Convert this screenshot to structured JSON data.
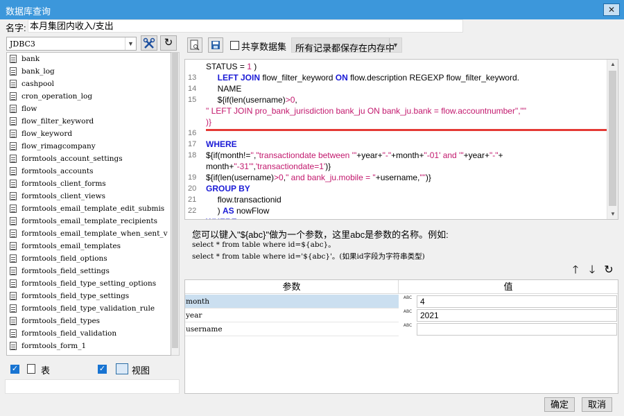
{
  "window": {
    "title": "数据库查询",
    "close_glyph": "✕"
  },
  "name_field": {
    "label": "名字:",
    "value": "本月集团内收入/支出"
  },
  "datasource": {
    "selected": "JDBC3",
    "arrow": "▼"
  },
  "tables": [
    "bank",
    "bank_log",
    "cashpool",
    "cron_operation_log",
    "flow",
    "flow_filter_keyword",
    "flow_keyword",
    "flow_rimagcompany",
    "formtools_account_settings",
    "formtools_accounts",
    "formtools_client_forms",
    "formtools_client_views",
    "formtools_email_template_edit_submis",
    "formtools_email_template_recipients",
    "formtools_email_template_when_sent_v",
    "formtools_email_templates",
    "formtools_field_options",
    "formtools_field_settings",
    "formtools_field_type_setting_options",
    "formtools_field_type_settings",
    "formtools_field_type_validation_rule",
    "formtools_field_types",
    "formtools_field_validation",
    "formtools_form_1"
  ],
  "filters": {
    "table_label": "表",
    "table_checked": true,
    "view_label": "视图",
    "view_checked": true
  },
  "toolbar": {
    "share_label": "共享数据集",
    "memory_option": "所有记录都保存在内存中",
    "arrow": "▼"
  },
  "sql_lines": [
    {
      "no": "",
      "parts": [
        [
          "t",
          "STATUS = "
        ],
        [
          "n",
          "1"
        ],
        [
          "t",
          " )"
        ]
      ]
    },
    {
      "no": "13",
      "parts": [
        [
          "t",
          "     "
        ],
        [
          "k",
          "LEFT JOIN"
        ],
        [
          "t",
          " flow_filter_keyword "
        ],
        [
          "k",
          "ON"
        ],
        [
          "t",
          " flow.description REGEXP flow_filter_keyword."
        ]
      ]
    },
    {
      "no": "14",
      "parts": [
        [
          "t",
          "     NAME"
        ]
      ]
    },
    {
      "no": "15",
      "parts": [
        [
          "t",
          "     ${if(len(username)"
        ],
        [
          "n",
          ">0"
        ],
        [
          "t",
          ","
        ]
      ]
    },
    {
      "no": "",
      "parts": [
        [
          "s",
          "\" LEFT JOIN pro_bank_jurisdiction bank_ju ON bank_ju.bank = flow.accountnumber\",\"\""
        ]
      ]
    },
    {
      "no": "",
      "parts": [
        [
          "s",
          ")}"
        ]
      ]
    },
    {
      "no": "16",
      "parts": []
    },
    {
      "no": "17",
      "parts": [
        [
          "k",
          "WHERE"
        ]
      ]
    },
    {
      "no": "18",
      "parts": [
        [
          "t",
          "${if(month!="
        ],
        [
          "s",
          "''"
        ],
        [
          "t",
          ","
        ],
        [
          "s",
          "\"transactiondate between '\""
        ],
        [
          "t",
          "+year+"
        ],
        [
          "s",
          "\"-\""
        ],
        [
          "t",
          "+month+"
        ],
        [
          "s",
          "\"-01' and '\""
        ],
        [
          "t",
          "+year+"
        ],
        [
          "s",
          "\"-\""
        ],
        [
          "t",
          "+"
        ]
      ]
    },
    {
      "no": "",
      "parts": [
        [
          "t",
          "month+"
        ],
        [
          "s",
          "\"-31'\""
        ],
        [
          "t",
          ","
        ],
        [
          "s",
          "'transactiondate=1'"
        ],
        [
          "t",
          ")}"
        ]
      ]
    },
    {
      "no": "19",
      "parts": [
        [
          "t",
          "${if(len(username)"
        ],
        [
          "n",
          ">0"
        ],
        [
          "t",
          ","
        ],
        [
          "s",
          "\" and bank_ju.mobile = \""
        ],
        [
          "t",
          "+username,"
        ],
        [
          "s",
          "\"\""
        ],
        [
          "t",
          ")}"
        ]
      ]
    },
    {
      "no": "20",
      "parts": [
        [
          "k",
          "GROUP BY"
        ]
      ]
    },
    {
      "no": "21",
      "parts": [
        [
          "t",
          "     flow.transactionid"
        ]
      ]
    },
    {
      "no": "22",
      "parts": [
        [
          "t",
          "     ) "
        ],
        [
          "k",
          "AS"
        ],
        [
          "t",
          " nowFlow"
        ]
      ]
    },
    {
      "no": "",
      "parts": [
        [
          "k",
          "WHERE"
        ]
      ]
    }
  ],
  "hint": {
    "line1": "您可以键入\"${abc}\"做为一个参数，这里abc是参数的名称。例如:",
    "line2": "select * from table where id=${abc}。",
    "line3": "select * from table where id='${abc}'。(如果id字段为字符串类型)"
  },
  "param_actions": {
    "up": "🡑",
    "down": "🡓",
    "refresh": "↻"
  },
  "params": {
    "col_name": "参数",
    "col_value": "值",
    "type_icon": "ABC",
    "rows": [
      {
        "name": "month",
        "value": "4"
      },
      {
        "name": "year",
        "value": "2021"
      },
      {
        "name": "username",
        "value": ""
      }
    ]
  },
  "buttons": {
    "ok": "确定",
    "cancel": "取消"
  }
}
